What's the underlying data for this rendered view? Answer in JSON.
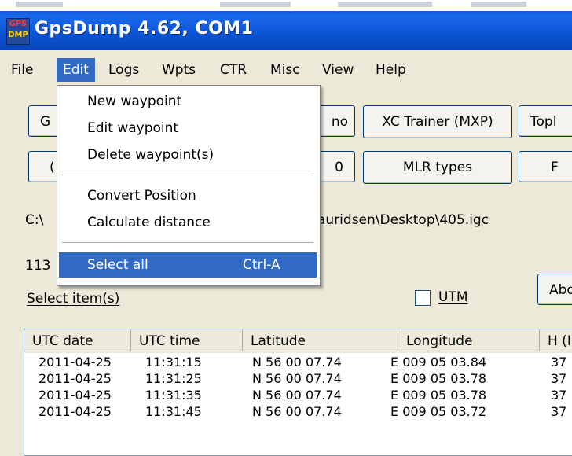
{
  "window": {
    "title": "GpsDump 4.62, COM1",
    "icon_line1": "GPS",
    "icon_line2": "DMP",
    "title_bar_color": "#0a5ee0"
  },
  "menubar": {
    "items": [
      "File",
      "Edit",
      "Logs",
      "Wpts",
      "CTR",
      "Misc",
      "View",
      "Help"
    ],
    "active": "Edit"
  },
  "buttons": {
    "b1_partial": "G",
    "b2_partial": "no",
    "b3": "XC Trainer (MXP)",
    "b4_partial": "Topl",
    "b5_partial": "(",
    "b6_partial": "0",
    "b7": "MLR types",
    "b8_partial": "F",
    "about_partial": "Abo"
  },
  "path": {
    "prefix": "C:\\",
    "suffix": "auridsen\\Desktop\\405.igc"
  },
  "count_partial": "113",
  "select_label": "Select item(s)",
  "utm_label": "UTM",
  "table": {
    "headers": [
      "UTC date",
      "UTC time",
      "Latitude",
      "Longitude",
      "H (I"
    ],
    "rows": [
      [
        "2011-04-25",
        "11:31:15",
        "N 56  00  07.74",
        "E 009  05  03.84",
        "37"
      ],
      [
        "2011-04-25",
        "11:31:25",
        "N 56  00  07.74",
        "E 009  05  03.78",
        "37"
      ],
      [
        "2011-04-25",
        "11:31:35",
        "N 56  00  07.74",
        "E 009  05  03.78",
        "37"
      ],
      [
        "2011-04-25",
        "11:31:45",
        "N 56  00  07.74",
        "E 009  05  03.72",
        "37"
      ]
    ]
  },
  "edit_menu": {
    "items": [
      {
        "label": "New waypoint"
      },
      {
        "label": "Edit waypoint"
      },
      {
        "label": "Delete waypoint(s)"
      },
      {
        "label": "Convert Position"
      },
      {
        "label": "Calculate distance"
      },
      {
        "label": "Select all",
        "shortcut": "Ctrl-A"
      }
    ],
    "highlight_color": "#316ac5"
  }
}
